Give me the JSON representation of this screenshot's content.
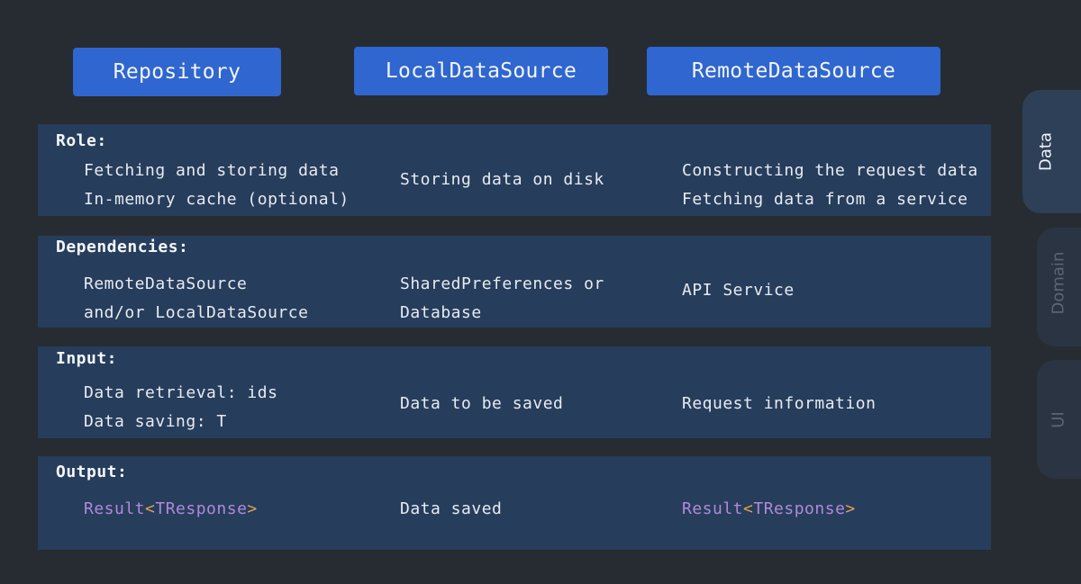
{
  "headers": {
    "repository": "Repository",
    "local": "LocalDataSource",
    "remote": "RemoteDataSource"
  },
  "side_tabs": {
    "data": "Data",
    "domain": "Domain",
    "ui": "UI"
  },
  "rows": {
    "role": {
      "title": "Role:",
      "repository": [
        "Fetching and storing data",
        "In-memory cache (optional)"
      ],
      "local": [
        "Storing data on disk"
      ],
      "remote": [
        "Constructing the request data",
        "Fetching data from a service"
      ]
    },
    "dependencies": {
      "title": "Dependencies:",
      "repository": [
        "RemoteDataSource",
        "and/or LocalDataSource"
      ],
      "local": [
        "SharedPreferences or",
        "Database"
      ],
      "remote": [
        "API Service"
      ]
    },
    "input": {
      "title": "Input:",
      "repository": [
        "Data retrieval: ids",
        "Data saving: T"
      ],
      "local": [
        "Data to be saved"
      ],
      "remote": [
        "Request information"
      ]
    },
    "output": {
      "title": "Output:",
      "repository": {
        "type": "Result",
        "open": "<",
        "param": "TResponse",
        "close": ">"
      },
      "local": [
        "Data saved"
      ],
      "remote": {
        "type": "Result",
        "open": "<",
        "param": "TResponse",
        "close": ">"
      }
    }
  },
  "colors": {
    "background": "#272c32",
    "header_button": "#2f66cf",
    "row": "#263d5c",
    "type_purple": "#b08ad8",
    "bracket_orange": "#e0a055"
  }
}
